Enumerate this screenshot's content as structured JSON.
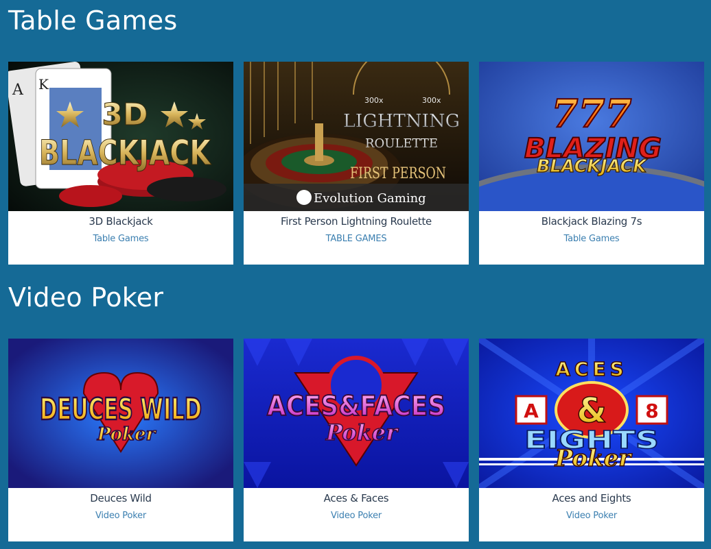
{
  "sections": [
    {
      "title": "Table Games",
      "games": [
        {
          "name": "3D Blackjack",
          "category": "Table Games",
          "art": {
            "line1": "3D",
            "line2": "BLACKJACK",
            "card_rank": "A",
            "card_rank2": "K"
          }
        },
        {
          "name": "First Person Lightning Roulette",
          "category": "TABLE GAMES",
          "art": {
            "line1": "LIGHTNING",
            "line2": "ROULETTE",
            "line3": "FIRST PERSON",
            "mult_left": "300x",
            "mult_right": "300x",
            "provider": "Evolution Gaming"
          }
        },
        {
          "name": "Blackjack Blazing 7s",
          "category": "Table Games",
          "art": {
            "sevens": "777",
            "line1": "BLAZING",
            "line2": "BLACKJACK"
          }
        }
      ]
    },
    {
      "title": "Video Poker",
      "games": [
        {
          "name": "Deuces Wild",
          "category": "Video Poker",
          "art": {
            "line1": "DEUCES WILD",
            "line2": "Poker"
          }
        },
        {
          "name": "Aces & Faces",
          "category": "Video Poker",
          "art": {
            "line1": "ACES&FACES",
            "line2": "Poker"
          }
        },
        {
          "name": "Aces and Eights",
          "category": "Video Poker",
          "art": {
            "top": "ACES",
            "card_left": "A",
            "amp": "&",
            "card_right": "8",
            "line2": "EIGHTS",
            "line3": "Poker"
          }
        }
      ]
    }
  ],
  "colors": {
    "background": "#156a96",
    "card_bg": "#ffffff",
    "name_text": "#2a3a4e",
    "category_text": "#3b7fb0"
  }
}
